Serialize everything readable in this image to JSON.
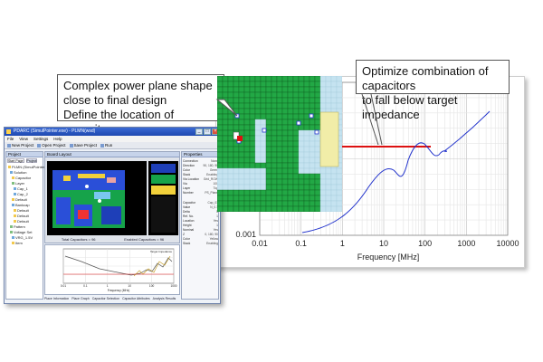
{
  "callouts": {
    "left": [
      "Complex power plane shape",
      "close to final design",
      "Define the location of capacitors."
    ],
    "right": [
      "Optimize combination of capacitors",
      "to fall below target impedance"
    ]
  },
  "plot": {
    "x_ticks": [
      "0.01",
      "0.1",
      "1",
      "10",
      "100",
      "1000",
      "10000"
    ],
    "y_ticks": [
      "0.001"
    ],
    "xlabel": "Frequency [MHz]"
  },
  "app": {
    "title": "PDARC (SimulPointer.exe) - PLMN(wsd)",
    "menu": [
      "File",
      "View",
      "Settings",
      "Help"
    ],
    "toolbar": [
      "New Project",
      "Open Project",
      "Save Project",
      "Run"
    ],
    "pane_titles": {
      "project": "Project",
      "center": "Board Layout",
      "properties": "Properties",
      "chart": "Impedance"
    },
    "project_tabs": [
      "Start Page",
      "Project"
    ],
    "tree": [
      "PLMN (SimulPointer)",
      "Solution",
      "Capacitor",
      "Layer",
      "Cap_1",
      "Cap_2",
      "Default",
      "Bankcap",
      "Default",
      "Default",
      "Default",
      "Pattern",
      "Voltage Set",
      "VRG_1.5V",
      "Item"
    ],
    "center_status": {
      "total": "Total Capacitors = 96",
      "enabled": "Enabled Capacitors = 96"
    },
    "properties": [
      {
        "k": "Connection",
        "v": "None"
      },
      {
        "k": "Direction",
        "v": "90, 180, 90"
      },
      {
        "k": "Color",
        "v": "Green"
      },
      {
        "k": "Stack",
        "v": "Enabling"
      },
      {
        "k": "Via Location",
        "v": "Grid_ROW"
      },
      {
        "k": "Via",
        "v": "100"
      },
      {
        "k": "Layer",
        "v": "Top"
      },
      {
        "k": "Number",
        "v": "PS_Plane"
      },
      {
        "k": "Capacitor",
        "v": "Cap_01"
      },
      {
        "k": "Value",
        "v": "N_0.1"
      },
      {
        "k": "Delta",
        "v": "5"
      },
      {
        "k": "Ref. No.",
        "v": "1"
      },
      {
        "k": "Location",
        "v": "Yes"
      },
      {
        "k": "Height",
        "v": "1"
      },
      {
        "k": "Nominal",
        "v": "Yes"
      },
      {
        "k": "Z",
        "v": "0, 180, 90"
      },
      {
        "k": "Color",
        "v": "Yellow"
      },
      {
        "k": "Stack",
        "v": "Enabling"
      }
    ],
    "mini_legend": "Target Impedance",
    "mini_xlabel": "Frequency (MHz)",
    "mini_x_ticks": [
      "0.01",
      "0.1",
      "1",
      "10",
      "100",
      "1000"
    ],
    "bottom_tabs": [
      "Place Information",
      "Place Graph",
      "Capacitor Selection",
      "Capacitor Attributes",
      "Analysis Results"
    ]
  }
}
